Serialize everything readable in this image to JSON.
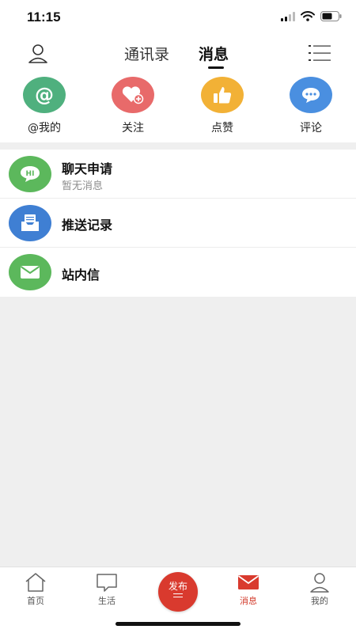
{
  "status_bar": {
    "time": "11:15"
  },
  "nav": {
    "tabs": [
      {
        "label": "通讯录"
      },
      {
        "label": "消息"
      }
    ],
    "active_tab": "消息"
  },
  "quick_actions": [
    {
      "label": "@我的",
      "icon": "at-icon",
      "color": "#4fb07e"
    },
    {
      "label": "关注",
      "icon": "heart-plus-icon",
      "color": "#e86a6a"
    },
    {
      "label": "点赞",
      "icon": "thumbs-up-icon",
      "color": "#f2b136"
    },
    {
      "label": "评论",
      "icon": "comment-icon",
      "color": "#4a8fe0"
    }
  ],
  "messages": [
    {
      "title": "聊天申请",
      "subtitle": "暂无消息",
      "icon": "hi-chat-icon",
      "color": "#5cb85c"
    },
    {
      "title": "推送记录",
      "icon": "inbox-tray-icon",
      "color": "#3f7fd3"
    },
    {
      "title": "站内信",
      "icon": "envelope-icon",
      "color": "#5cb85c"
    }
  ],
  "bottom_nav": {
    "items": [
      {
        "label": "首页",
        "icon": "home-icon"
      },
      {
        "label": "生活",
        "icon": "speech-bubble-icon"
      },
      {
        "label": "发布",
        "icon": "publish-icon"
      },
      {
        "label": "消息",
        "icon": "mail-icon"
      },
      {
        "label": "我的",
        "icon": "person-icon"
      }
    ],
    "active": "消息",
    "accent_color": "#d93a2e"
  }
}
